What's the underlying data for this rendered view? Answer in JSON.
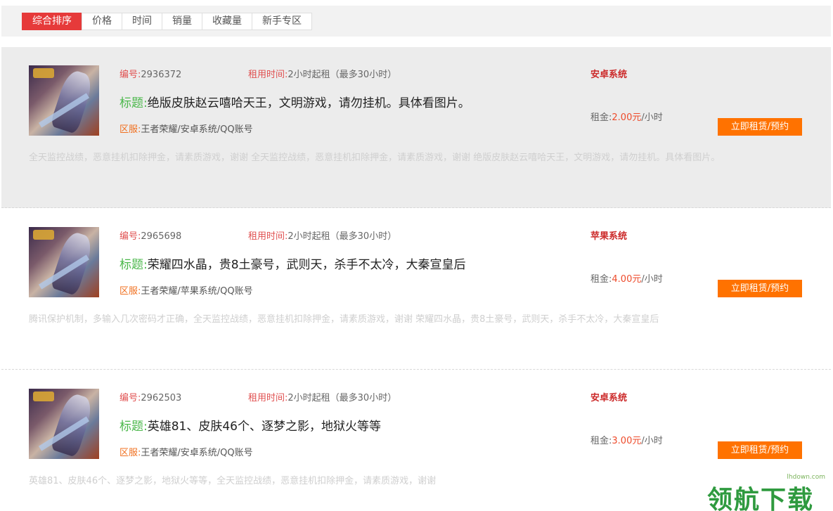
{
  "sort_tabs": [
    "综合排序",
    "价格",
    "时间",
    "销量",
    "收藏量",
    "新手专区"
  ],
  "labels": {
    "id": "编号:",
    "rent_time": "租用时间:",
    "title": "标题:",
    "server": "区服:",
    "price_prefix": "租金:",
    "price_unit": "/小时",
    "button": "立即租赁/预约"
  },
  "items": [
    {
      "id": "2936372",
      "rent_time": "2小时起租（最多30小时）",
      "title": "绝版皮肤赵云嘻哈天王，文明游戏，请勿挂机。具体看图片。",
      "server": "王者荣耀/安卓系统/QQ账号",
      "description": "全天监控战绩，恶意挂机扣除押金，请素质游戏，谢谢 全天监控战绩，恶意挂机扣除押金，请素质游戏，谢谢 绝版皮肤赵云嘻哈天王，文明游戏，请勿挂机。具体看图片。",
      "system": "安卓系统",
      "price": "2.00元"
    },
    {
      "id": "2965698",
      "rent_time": "2小时起租（最多30小时）",
      "title": "荣耀四水晶，贵8土豪号，武则天，杀手不太冷，大秦宣皇后",
      "server": "王者荣耀/苹果系统/QQ账号",
      "description": "腾讯保护机制，多输入几次密码才正确，全天监控战绩，恶意挂机扣除押金，请素质游戏，谢谢 荣耀四水晶，贵8土豪号，武则天，杀手不太冷，大秦宣皇后",
      "system": "苹果系统",
      "price": "4.00元"
    },
    {
      "id": "2962503",
      "rent_time": "2小时起租（最多30小时）",
      "title": "英雄81、皮肤46个、逐梦之影，地狱火等等",
      "server": "王者荣耀/安卓系统/QQ账号",
      "description": "英雄81、皮肤46个、逐梦之影，地狱火等等，全天监控战绩，恶意挂机扣除押金，请素质游戏，谢谢",
      "system": "安卓系统",
      "price": "3.00元"
    }
  ],
  "watermark": {
    "text": "领航下载",
    "url": "lhdown.com"
  }
}
